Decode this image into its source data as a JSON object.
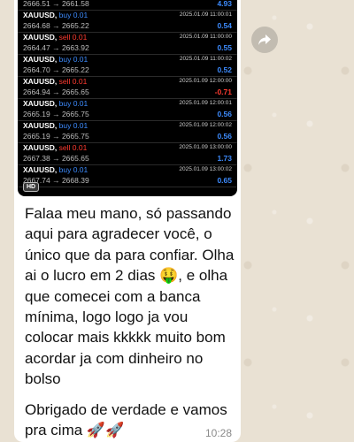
{
  "trades": [
    {
      "symbol": "",
      "side": "",
      "side_type": "",
      "timestamp": "",
      "prices": "2666.51 → 2661.58",
      "profit": "4.93",
      "profit_type": "pos"
    },
    {
      "symbol": "XAUUSD,",
      "side": "buy 0.01",
      "side_type": "buy",
      "timestamp": "2025.01.09 11:00:01",
      "prices": "2664.68 → 2665.22",
      "profit": "0.54",
      "profit_type": "pos"
    },
    {
      "symbol": "XAUUSD,",
      "side": "sell 0.01",
      "side_type": "sell",
      "timestamp": "2025.01.09 11:00:00",
      "prices": "2664.47 → 2663.92",
      "profit": "0.55",
      "profit_type": "pos"
    },
    {
      "symbol": "XAUUSD,",
      "side": "buy 0.01",
      "side_type": "buy",
      "timestamp": "2025.01.09 11:00:02",
      "prices": "2664.70 → 2665.22",
      "profit": "0.52",
      "profit_type": "pos"
    },
    {
      "symbol": "XAUUSD,",
      "side": "sell 0.01",
      "side_type": "sell",
      "timestamp": "2025.01.09 12:00:00",
      "prices": "2664.94 → 2665.65",
      "profit": "-0.71",
      "profit_type": "neg"
    },
    {
      "symbol": "XAUUSD,",
      "side": "buy 0.01",
      "side_type": "buy",
      "timestamp": "2025.01.09 12:00:01",
      "prices": "2665.19 → 2665.75",
      "profit": "0.56",
      "profit_type": "pos"
    },
    {
      "symbol": "XAUUSD,",
      "side": "buy 0.01",
      "side_type": "buy",
      "timestamp": "2025.01.09 12:00:02",
      "prices": "2665.19 → 2665.75",
      "profit": "0.56",
      "profit_type": "pos"
    },
    {
      "symbol": "XAUUSD,",
      "side": "sell 0.01",
      "side_type": "sell",
      "timestamp": "2025.01.09 13:00:00",
      "prices": "2667.38 → 2665.65",
      "profit": "1.73",
      "profit_type": "pos"
    },
    {
      "symbol": "XAUUSD,",
      "side": "buy 0.01",
      "side_type": "buy",
      "timestamp": "2025.01.09 13:00:02",
      "prices": "2667.74 → 2668.39",
      "profit": "0.65",
      "profit_type": "pos"
    }
  ],
  "hd_badge": "HD",
  "message": "Falaa meu mano, só passando aqui para agradecer você, o único que da para confiar. Olha ai o lucro em 2 dias 🤑, e olha que comecei com a banca mínima, logo logo ja vou colocar mais kkkkk muito bom acordar ja com dinheiro no bolso",
  "message_tail": "Obrigado de verdade e vamos pra cima 🚀🚀",
  "time": "10:28",
  "forward_icon": "forward-arrow-icon"
}
